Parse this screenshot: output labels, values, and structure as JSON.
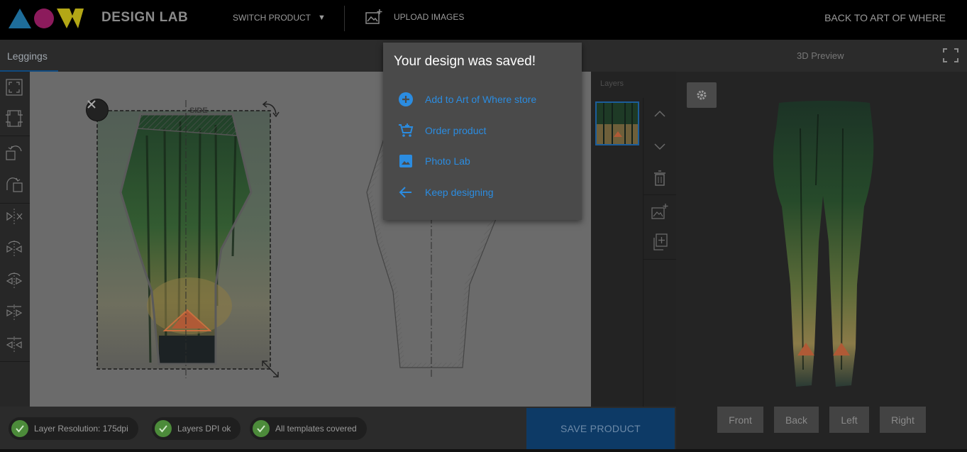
{
  "header": {
    "brand": "DESIGN LAB",
    "switch_product": "SWITCH PRODUCT",
    "upload_images": "UPLOAD IMAGES",
    "back_link": "BACK TO ART OF WHERE"
  },
  "tabs": {
    "active": "Leggings"
  },
  "canvas": {
    "side_label": "SIDE"
  },
  "layers": {
    "title": "Layers"
  },
  "preview": {
    "title": "3D Preview",
    "views": [
      "Front",
      "Back",
      "Left",
      "Right"
    ]
  },
  "status": {
    "resolution": "Layer Resolution: 175dpi",
    "dpi": "Layers DPI ok",
    "templates": "All templates covered"
  },
  "actions": {
    "save_product": "SAVE PRODUCT"
  },
  "popup": {
    "title": "Your design was saved!",
    "items": [
      {
        "label": "Add to Art of Where store",
        "icon": "add-circle-icon"
      },
      {
        "label": "Order product",
        "icon": "cart-icon"
      },
      {
        "label": "Photo Lab",
        "icon": "image-icon"
      },
      {
        "label": "Keep designing",
        "icon": "arrow-back-icon"
      }
    ]
  },
  "colors": {
    "accent_link": "#2b8ce0",
    "save_button": "#0d3a66",
    "ok_badge": "#4c8b3a"
  }
}
